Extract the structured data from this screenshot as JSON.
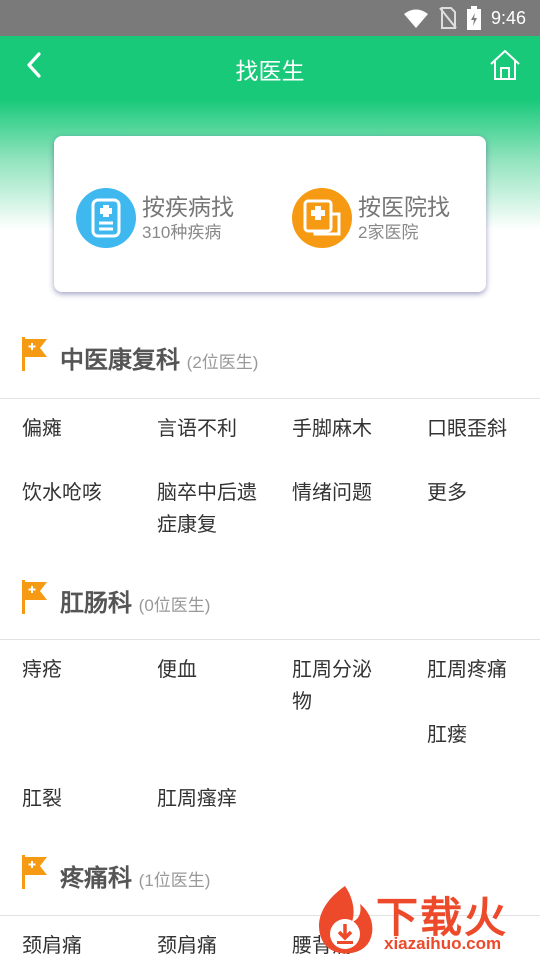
{
  "status_bar": {
    "time": "9:46"
  },
  "header": {
    "title": "找医生"
  },
  "search_options": [
    {
      "title": "按疾病找",
      "subtitle": "310种疾病",
      "icon": "medical-record-icon",
      "color": "#3fb8f0"
    },
    {
      "title": "按医院找",
      "subtitle": "2家医院",
      "icon": "hospital-icon",
      "color": "#f59a12"
    }
  ],
  "departments": [
    {
      "name": "中医康复科",
      "count": "(2位医生)",
      "items": [
        "偏瘫",
        "言语不利",
        "手脚麻木",
        "口眼歪斜",
        "饮水呛咳",
        "脑卒中后遗症康复",
        "情绪问题",
        "更多"
      ]
    },
    {
      "name": "肛肠科",
      "count": "(0位医生)",
      "items": [
        "痔疮",
        "便血",
        "肛周分泌物",
        "肛周疼痛",
        "肛瘘",
        "肛裂",
        "肛周瘙痒"
      ]
    },
    {
      "name": "疼痛科",
      "count": "(1位医生)",
      "items": [
        "颈肩痛",
        "颈肩痛",
        "腰背痛"
      ]
    }
  ],
  "watermark": {
    "brand": "下载火",
    "url": "xiazaihuo.com"
  },
  "colors": {
    "primary": "#19c97a",
    "flag": "#f59a12",
    "watermark": "#ec4a2b"
  }
}
